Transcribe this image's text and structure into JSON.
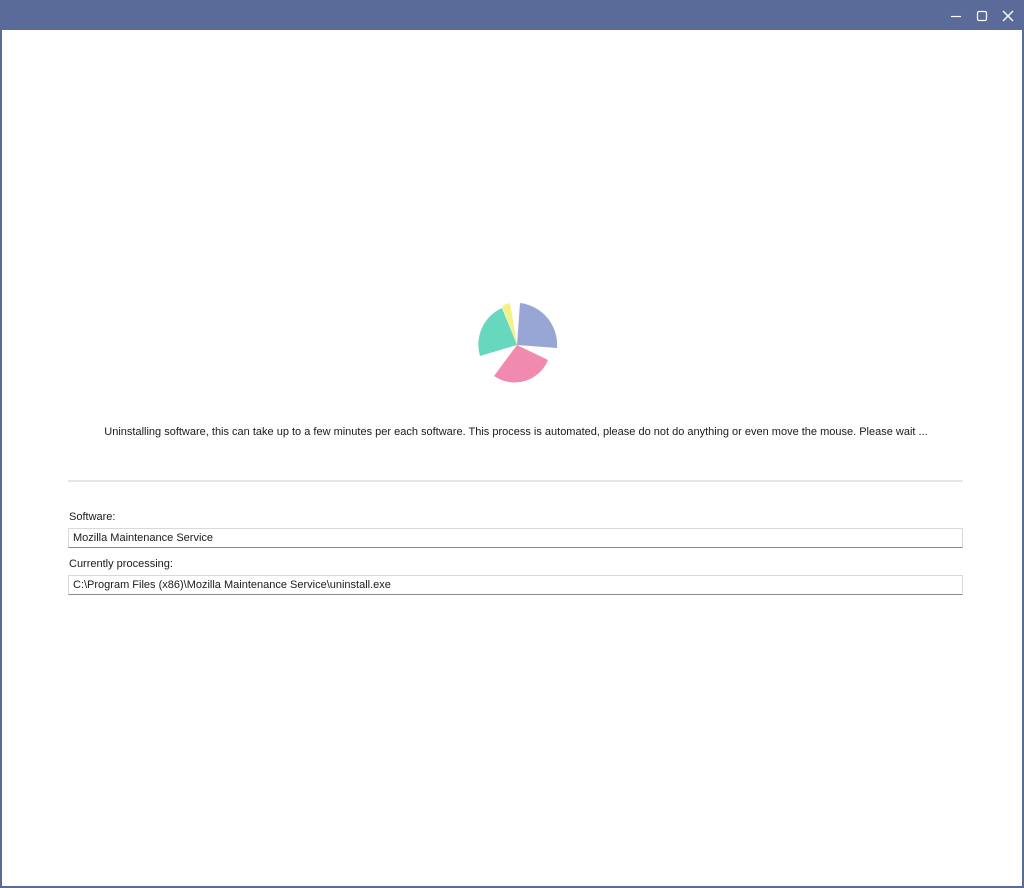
{
  "window": {
    "title": "",
    "minimize_icon": "minimize-icon",
    "maximize_icon": "maximize-icon",
    "close_icon": "close-icon",
    "titlebar_color": "#5a6a99"
  },
  "spinner": {
    "icon": "loading-pie-spinner",
    "colors": [
      "#97a6d4",
      "#f08aae",
      "#67d7bd",
      "#f3f086"
    ]
  },
  "status": {
    "message": "Uninstalling software, this can take up to a few minutes per each software. This process is automated, please do not do anything or even move the mouse. Please wait ..."
  },
  "fields": {
    "software_label": "Software:",
    "software_value": "Mozilla Maintenance Service",
    "processing_label": "Currently processing:",
    "processing_value": "C:\\Program Files (x86)\\Mozilla Maintenance Service\\uninstall.exe"
  }
}
